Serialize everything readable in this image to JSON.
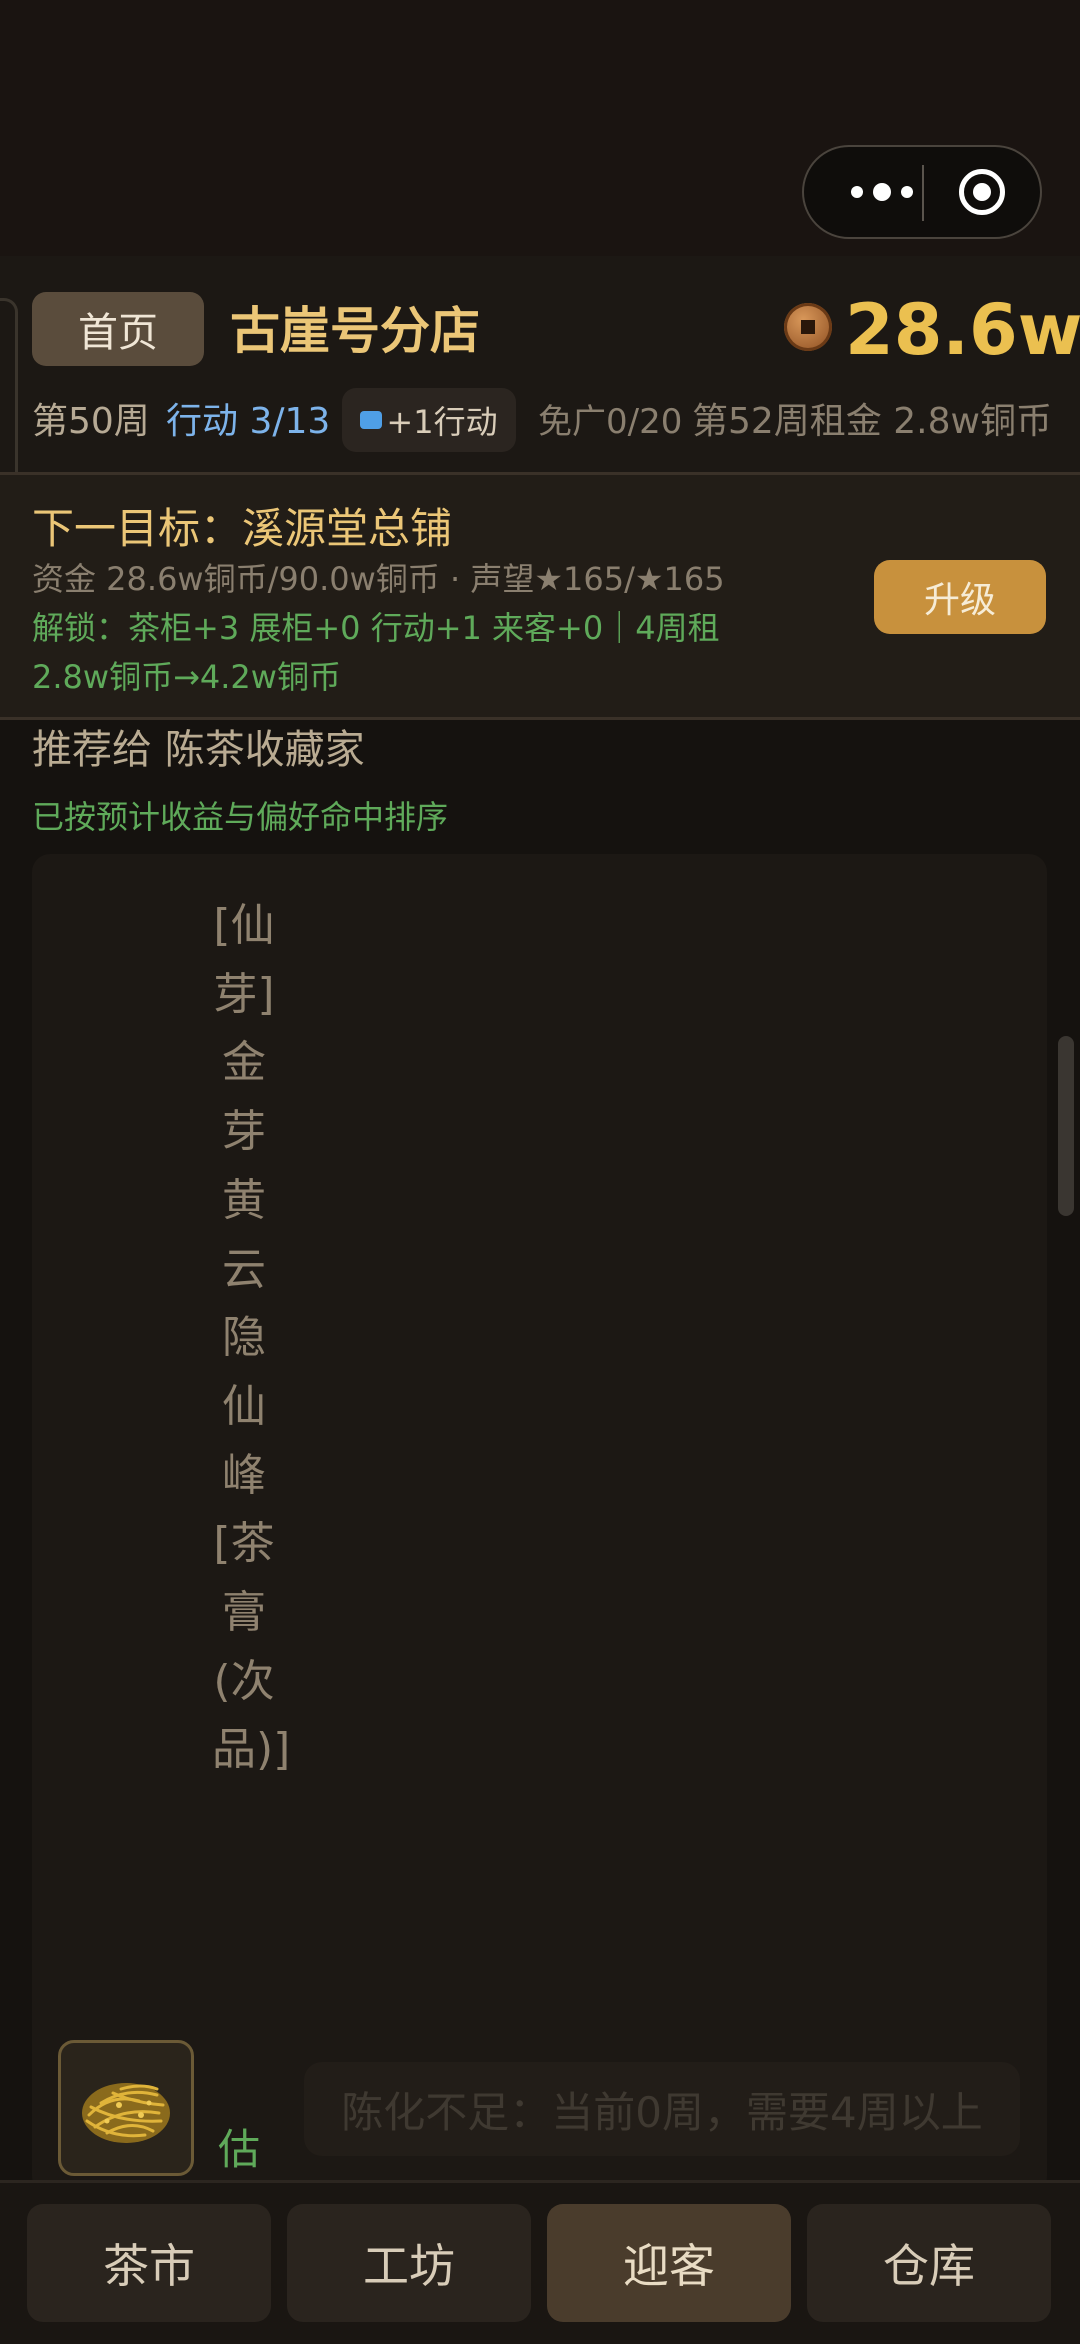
{
  "capsule": {
    "more_icon": "more-dots-icon",
    "close_icon": "target-circle-icon"
  },
  "header": {
    "home_label": "首页",
    "shop_name": "古崖号分店",
    "coin_icon": "copper-coin-icon",
    "money": "28.6w",
    "week": "第50周",
    "action": "行动 3/13",
    "ad_action_label": "+1行动",
    "free_ad": "免广0/20",
    "rent": "第52周租金 2.8w铜币"
  },
  "goal": {
    "title": "下一目标：溪源堂总铺",
    "funds": "资金 28.6w铜币/90.0w铜币 · 声望★165/★165",
    "unlock": "解锁：茶柜+3 展柜+0 行动+1 来客+0｜4周租2.8w铜币→4.2w铜币",
    "upgrade_label": "升级"
  },
  "recommend": {
    "title": "推荐给 陈茶收藏家",
    "subtitle": "已按预计收益与偏好命中排序"
  },
  "product": {
    "name": "[仙芽]金芽黄云隐仙峰[茶膏(次品)]",
    "estimate": "估",
    "thumb_icon": "golden-tea-leaves-icon",
    "action_label": "陈化不足：当前0周，需要4周以上"
  },
  "nav": {
    "items": [
      {
        "label": "茶市",
        "active": false
      },
      {
        "label": "工坊",
        "active": false
      },
      {
        "label": "迎客",
        "active": true
      },
      {
        "label": "仓库",
        "active": false
      }
    ]
  },
  "colors": {
    "accent_gold": "#ebc677",
    "money_gold": "#ebc050",
    "action_blue": "#7db3ea",
    "unlock_green": "#5faa5a",
    "upgrade_button": "#c8913d"
  }
}
